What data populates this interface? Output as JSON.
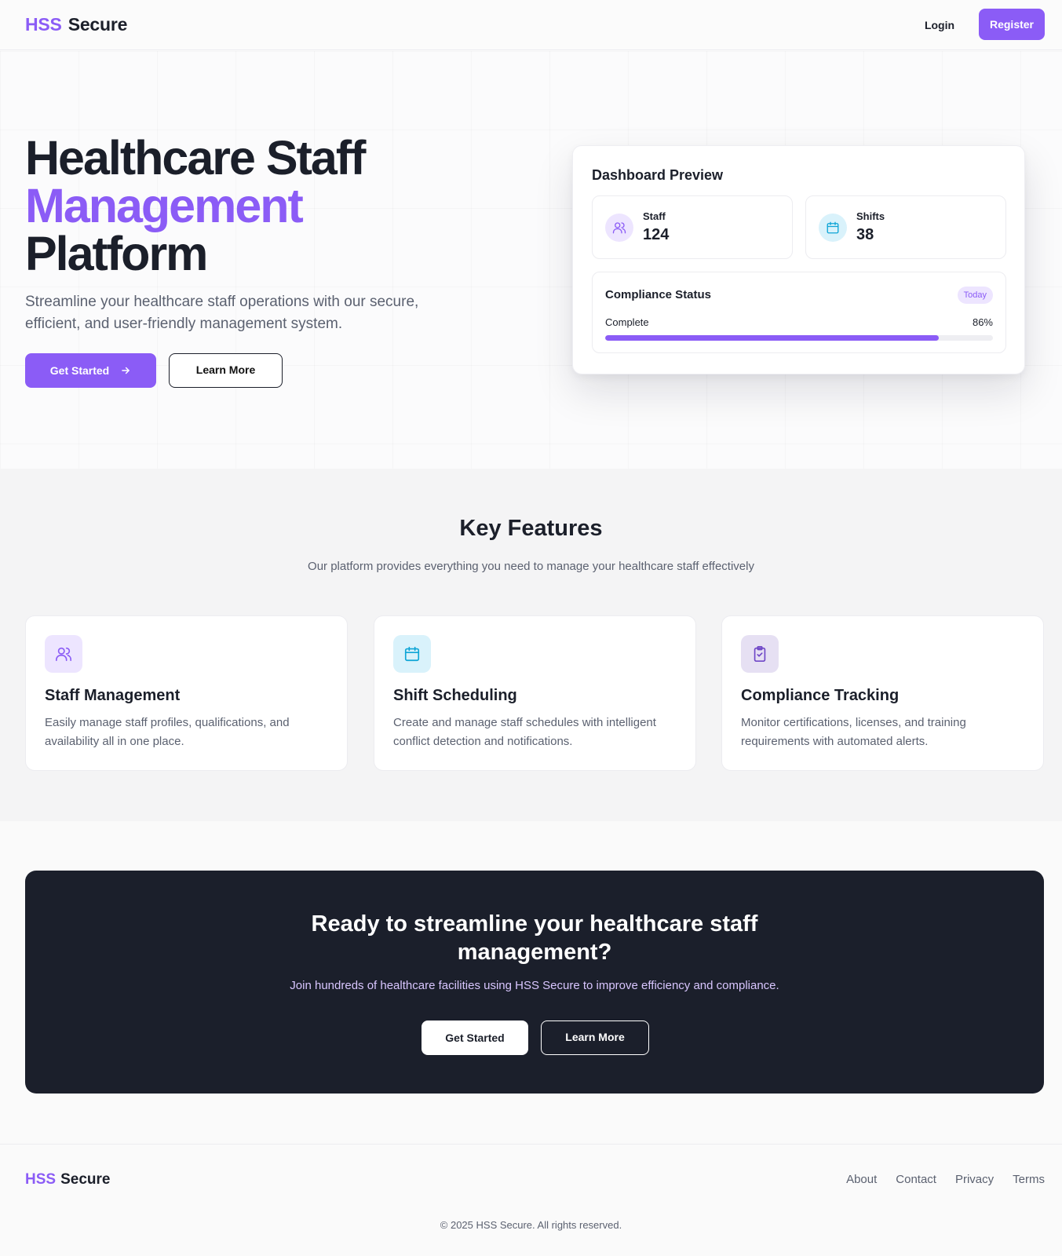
{
  "header": {
    "logo_primary": "HSS",
    "logo_secondary": "Secure",
    "login_label": "Login",
    "register_label": "Register"
  },
  "hero": {
    "title_line1": "Healthcare Staff",
    "title_line2": "Management",
    "title_line3": "Platform",
    "subtitle": "Streamline your healthcare staff operations with our secure, efficient, and user-friendly management system.",
    "primary_button": "Get Started",
    "primary_button_icon": "arrow-right-icon",
    "secondary_button": "Learn More"
  },
  "dashboard": {
    "title": "Dashboard Preview",
    "stats": [
      {
        "label": "Staff",
        "value": "124",
        "icon": "users-icon"
      },
      {
        "label": "Shifts",
        "value": "38",
        "icon": "calendar-icon"
      }
    ],
    "compliance": {
      "title": "Compliance Status",
      "badge": "Today",
      "label": "Complete",
      "percent_text": "86%",
      "percent": 86
    }
  },
  "features": {
    "title": "Key Features",
    "subtitle": "Our platform provides everything you need to manage your healthcare staff effectively",
    "items": [
      {
        "title": "Staff Management",
        "description": "Easily manage staff profiles, qualifications, and availability all in one place.",
        "icon": "users-icon"
      },
      {
        "title": "Shift Scheduling",
        "description": "Create and manage staff schedules with intelligent conflict detection and notifications.",
        "icon": "calendar-icon"
      },
      {
        "title": "Compliance Tracking",
        "description": "Monitor certifications, licenses, and training requirements with automated alerts.",
        "icon": "clipboard-check-icon"
      }
    ]
  },
  "cta": {
    "title": "Ready to streamline your healthcare staff management?",
    "subtitle": "Join hundreds of healthcare facilities using HSS Secure to improve efficiency and compliance.",
    "primary_button": "Get Started",
    "secondary_button": "Learn More"
  },
  "footer": {
    "logo_primary": "HSS",
    "logo_secondary": "Secure",
    "links": [
      "About",
      "Contact",
      "Privacy",
      "Terms"
    ],
    "copyright": "© 2025 HSS Secure. All rights reserved."
  },
  "colors": {
    "accent": "#8b5cf6",
    "dark": "#1b1f2b",
    "cyan": "#0ea5d6"
  }
}
